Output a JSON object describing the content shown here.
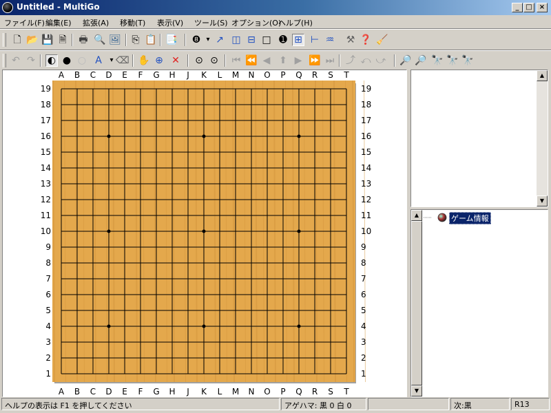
{
  "window": {
    "title": "Untitled - MultiGo",
    "controls": [
      "_",
      "□",
      "×"
    ]
  },
  "menu": [
    "ファイル(F)",
    "編集(E)",
    "拡張(A)",
    "移動(T)",
    "表示(V)",
    "ツール(S)",
    "オプション(O)",
    "ヘルプ(H)"
  ],
  "toolbar1": [
    {
      "icon": "new-file-icon",
      "glyph": "🗋"
    },
    {
      "icon": "open-folder-icon",
      "glyph": "📂"
    },
    {
      "icon": "save-icon",
      "glyph": "💾"
    },
    {
      "icon": "save-as-icon",
      "glyph": "🗎"
    },
    {
      "icon": "print-icon",
      "glyph": "🖶"
    },
    {
      "icon": "print-preview-icon",
      "glyph": "🔍"
    },
    {
      "icon": "image-icon",
      "glyph": "🖼"
    },
    {
      "icon": "copy-icon",
      "glyph": "⎘"
    },
    {
      "icon": "paste-icon",
      "glyph": "📋"
    },
    {
      "icon": "properties-icon",
      "glyph": "📑"
    },
    {
      "icon": "move-number-icon",
      "glyph": "❽"
    },
    {
      "icon": "dropdown-arrow-icon",
      "glyph": "▾"
    },
    {
      "icon": "goto-icon",
      "glyph": "↗"
    },
    {
      "icon": "vertical-split-icon",
      "glyph": "◫"
    },
    {
      "icon": "horizontal-split-icon",
      "glyph": "⊟"
    },
    {
      "icon": "blank-panel-icon",
      "glyph": "□"
    },
    {
      "icon": "number-one-icon",
      "glyph": "➊"
    },
    {
      "icon": "tree-view-icon",
      "glyph": "⊞"
    },
    {
      "icon": "tree-branch-icon",
      "glyph": "⊢"
    },
    {
      "icon": "hierarchy-icon",
      "glyph": "♒"
    },
    {
      "icon": "tools-icon",
      "glyph": "⚒"
    },
    {
      "icon": "help-icon",
      "glyph": "❓"
    },
    {
      "icon": "cleanup-icon",
      "glyph": "🧹"
    }
  ],
  "toolbar2": [
    {
      "icon": "undo-icon",
      "glyph": "↶"
    },
    {
      "icon": "redo-icon",
      "glyph": "↷"
    },
    {
      "icon": "alternate-stones-icon",
      "glyph": "◐"
    },
    {
      "icon": "black-stone-icon",
      "glyph": "●"
    },
    {
      "icon": "white-stone-icon",
      "glyph": "○"
    },
    {
      "icon": "letter-mark-icon",
      "glyph": "A"
    },
    {
      "icon": "dropdown-arrow-icon",
      "glyph": "▾"
    },
    {
      "icon": "eraser-icon",
      "glyph": "⌫"
    },
    {
      "icon": "hand-icon",
      "glyph": "✋"
    },
    {
      "icon": "add-variation-icon",
      "glyph": "⊕"
    },
    {
      "icon": "delete-icon",
      "glyph": "✕"
    },
    {
      "icon": "previous-variation-icon",
      "glyph": "⊙"
    },
    {
      "icon": "next-variation-icon",
      "glyph": "⊙"
    },
    {
      "icon": "first-move-icon",
      "glyph": "⏮"
    },
    {
      "icon": "fast-back-icon",
      "glyph": "⏪"
    },
    {
      "icon": "back-icon",
      "glyph": "◀"
    },
    {
      "icon": "up-icon",
      "glyph": "⬆"
    },
    {
      "icon": "forward-icon",
      "glyph": "▶"
    },
    {
      "icon": "fast-forward-icon",
      "glyph": "⏩"
    },
    {
      "icon": "last-move-icon",
      "glyph": "⏭"
    },
    {
      "icon": "branch-up-icon",
      "glyph": "⤴"
    },
    {
      "icon": "branch-back-icon",
      "glyph": "⤺"
    },
    {
      "icon": "branch-forward-icon",
      "glyph": "⤻"
    },
    {
      "icon": "search-icon",
      "glyph": "🔎"
    },
    {
      "icon": "search-next-icon",
      "glyph": "🔎"
    },
    {
      "icon": "find-icon",
      "glyph": "🔭"
    },
    {
      "icon": "find-prev-icon",
      "glyph": "🔭"
    },
    {
      "icon": "find-next-icon",
      "glyph": "🔭"
    }
  ],
  "board": {
    "size": 19,
    "columns": [
      "A",
      "B",
      "C",
      "D",
      "E",
      "F",
      "G",
      "H",
      "J",
      "K",
      "L",
      "M",
      "N",
      "O",
      "P",
      "Q",
      "R",
      "S",
      "T"
    ],
    "rows": [
      "19",
      "18",
      "17",
      "16",
      "15",
      "14",
      "13",
      "12",
      "11",
      "10",
      "9",
      "8",
      "7",
      "6",
      "5",
      "4",
      "3",
      "2",
      "1"
    ],
    "star_points": [
      "D16",
      "K16",
      "Q16",
      "D10",
      "K10",
      "Q10",
      "D4",
      "K4",
      "Q4"
    ],
    "stones": [],
    "wood_color": "#e4a84c",
    "line_color": "#000000"
  },
  "tree": {
    "root_label": "ゲーム情報"
  },
  "status": {
    "help": "ヘルプの表示は F1 を押してください",
    "captures": "アゲハマ: 黒 0 白 0",
    "empty": "",
    "next": "次:黒",
    "rule": "R13"
  }
}
